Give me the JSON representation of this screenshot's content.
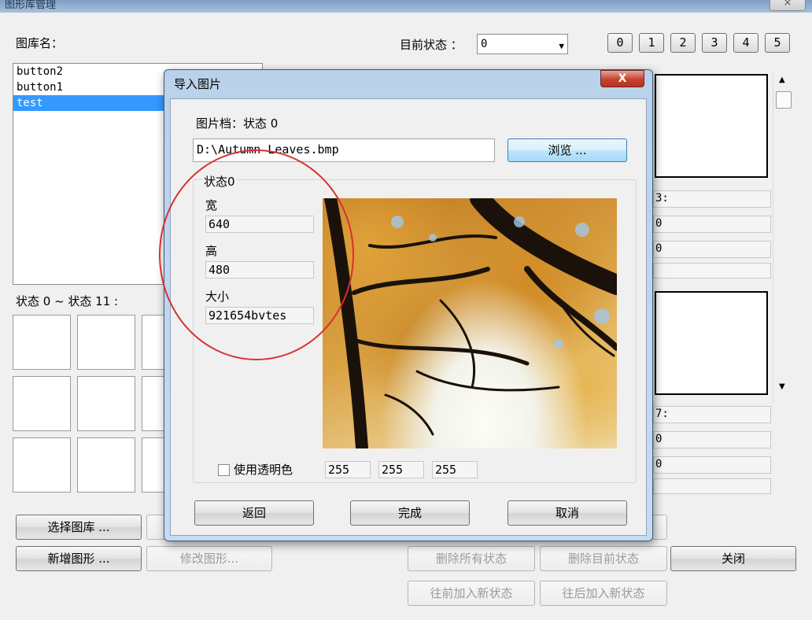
{
  "window": {
    "title": "图形库管理",
    "close_label": "⨯"
  },
  "library": {
    "label": "图库名：",
    "items": [
      "button2",
      "button1",
      "test"
    ],
    "selected_index": 2
  },
  "state_selector": {
    "label": "目前状态 ：",
    "value": "0",
    "number_buttons": [
      "0",
      "1",
      "2",
      "3",
      "4",
      "5"
    ]
  },
  "states_grid": {
    "label": "状态 0 ~ 状态 11 :"
  },
  "right_panel": {
    "fields_top": [
      "3:",
      "0",
      "0",
      ""
    ],
    "fields_bottom": [
      "7:",
      "0",
      "0",
      ""
    ]
  },
  "buttons": {
    "select_library": "选择图库 ...",
    "add_shape": "新增图形 ...",
    "modify_shape": "修改图形...",
    "delete_all_states": "删除所有状态",
    "delete_current_state": "删除目前状态",
    "close": "关闭",
    "insert_before": "往前加入新状态",
    "insert_after": "往后加入新状态"
  },
  "dialog": {
    "title": "导入图片",
    "close_label": "X",
    "file_label": "图片档：状态 0",
    "file_path": "D:\\Autumn Leaves.bmp",
    "browse": "浏览 ...",
    "group_label": "状态0",
    "width_label": "宽",
    "width_value": "640",
    "height_label": "高",
    "height_value": "480",
    "size_label": "大小",
    "size_value": "921654bvtes",
    "transparent_label": "使用透明色",
    "rgb": [
      "255",
      "255",
      "255"
    ],
    "back": "返回",
    "done": "完成",
    "cancel": "取消"
  }
}
